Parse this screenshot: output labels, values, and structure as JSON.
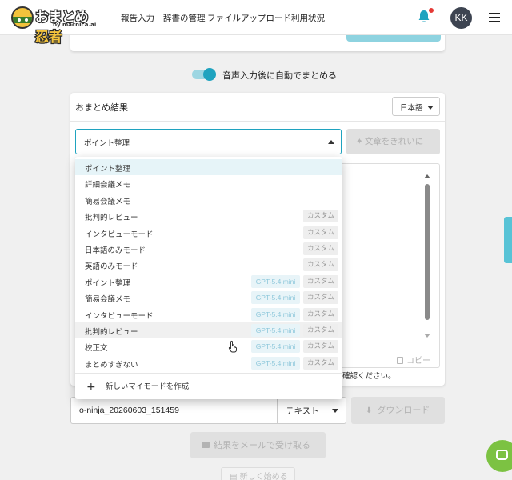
{
  "header": {
    "logo_text_1": "おまとめ",
    "logo_text_2": "忍者",
    "logo_sub": "by macnica.ai",
    "nav": [
      "報告入力",
      "辞書の管理",
      "ファイルアップロード",
      "利用状況"
    ],
    "avatar_initials": "KK",
    "notification_dot_color": "#e53935"
  },
  "auto_summary_toggle": {
    "label": "音声入力後に自動でまとめる",
    "on": true
  },
  "result_card": {
    "title": "おまとめ結果",
    "language": "日本語",
    "mode_selected": "ポイント整理",
    "clean_button": "文章をきれいに",
    "copy_label": "コピー",
    "notice_text": "確認ください。"
  },
  "dropdown": {
    "options": [
      {
        "label": "ポイント整理",
        "gpt": "",
        "custom": ""
      },
      {
        "label": "詳細会議メモ",
        "gpt": "",
        "custom": ""
      },
      {
        "label": "簡易会議メモ",
        "gpt": "",
        "custom": ""
      },
      {
        "label": "批判的レビュー",
        "gpt": "",
        "custom": "カスタム"
      },
      {
        "label": "インタビューモード",
        "gpt": "",
        "custom": "カスタム"
      },
      {
        "label": "日本語のみモード",
        "gpt": "",
        "custom": "カスタム"
      },
      {
        "label": "英語のみモード",
        "gpt": "",
        "custom": "カスタム"
      },
      {
        "label": "ポイント整理",
        "gpt": "GPT-5.4 mini",
        "custom": "カスタム"
      },
      {
        "label": "簡易会議メモ",
        "gpt": "GPT-5.4 mini",
        "custom": "カスタム"
      },
      {
        "label": "インタビューモード",
        "gpt": "GPT-5.4 mini",
        "custom": "カスタム"
      },
      {
        "label": "批判的レビュー",
        "gpt": "GPT-5.4 mini",
        "custom": "カスタム"
      },
      {
        "label": "校正文",
        "gpt": "GPT-5.4 mini",
        "custom": "カスタム"
      },
      {
        "label": "まとめすぎない",
        "gpt": "GPT-5.4 mini",
        "custom": "カスタム"
      }
    ],
    "new_mode": "新しいマイモードを作成"
  },
  "export": {
    "filename": "o-ninja_20260603_151459",
    "format": "テキスト",
    "download_button": "ダウンロード",
    "mail_button": "結果をメールで受け取る",
    "restart_button": "新しく始める"
  },
  "colors": {
    "accent": "#1fa3bf",
    "selected_row": "#e6f4f8",
    "hover_row": "#f0f0f0",
    "chat_fab": "#7cc242"
  }
}
